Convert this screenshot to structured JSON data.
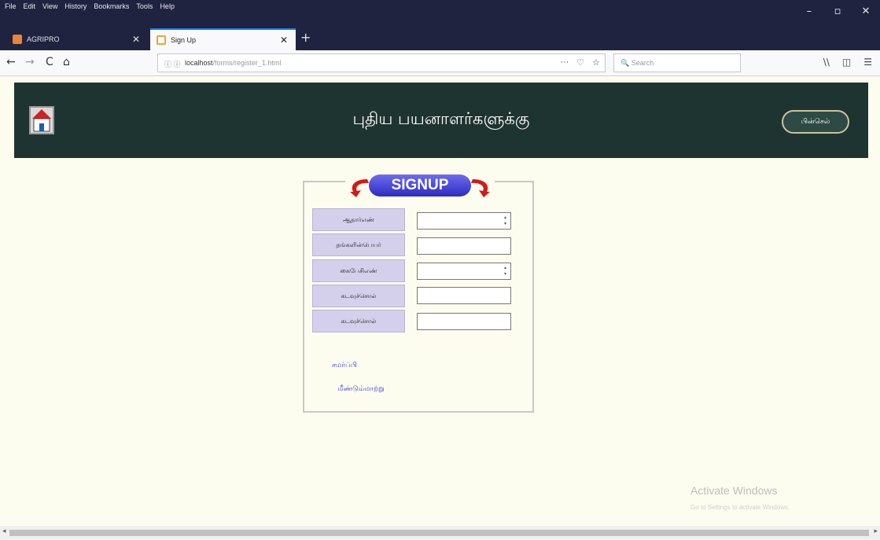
{
  "browser": {
    "menu": [
      "File",
      "Edit",
      "View",
      "History",
      "Bookmarks",
      "Tools",
      "Help"
    ],
    "window_controls": {
      "minimize": "–",
      "maximize": "▫",
      "close": "✕"
    },
    "tabs": [
      {
        "label": "AGRIPRO",
        "close": "✕"
      },
      {
        "label": "Sign Up",
        "close": "✕"
      }
    ],
    "new_tab": "+",
    "nav": {
      "back": "←",
      "forward": "→",
      "reload": "C",
      "home": "⌂"
    },
    "url_info": "ⓘ ⓘ",
    "url_host": "localhost",
    "url_path": "/forms/register_1.html",
    "url_tools": {
      "more": "···",
      "pocket": "♡",
      "bookmark": "☆"
    },
    "search_placeholder": "🔍 Search",
    "right_tools": {
      "library": "\\\\",
      "sidebar": "◫",
      "menu": "☰"
    }
  },
  "header": {
    "title": "புதிய பயனாளர்களுக்கு",
    "back_label": "பின்செல்"
  },
  "form": {
    "legend": "SIGNUP",
    "fields": [
      {
        "label": "ஆதார்எண்",
        "kind": "number",
        "value": ""
      },
      {
        "label": "தங்களின்பெயர்",
        "kind": "text",
        "value": ""
      },
      {
        "label": "கைபேசிஎண்",
        "kind": "number",
        "value": ""
      },
      {
        "label": "கடவுச்சொல்",
        "kind": "password",
        "value": ""
      },
      {
        "label": "கடவுச்சொல்",
        "kind": "password",
        "value": ""
      }
    ],
    "submit_label": "சமர்ப்பி",
    "reset_label": "மீண்டும்மாற்று"
  },
  "watermark": {
    "title": "Activate Windows",
    "subtitle": "Go to Settings to activate Windows."
  },
  "colors": {
    "menubar": "#202340",
    "header": "#1e3430",
    "page_bg": "#fdfdef",
    "signup_badge": "#4a48de",
    "label_bg": "#d4d0ec",
    "button_text": "#3a3ad0"
  }
}
